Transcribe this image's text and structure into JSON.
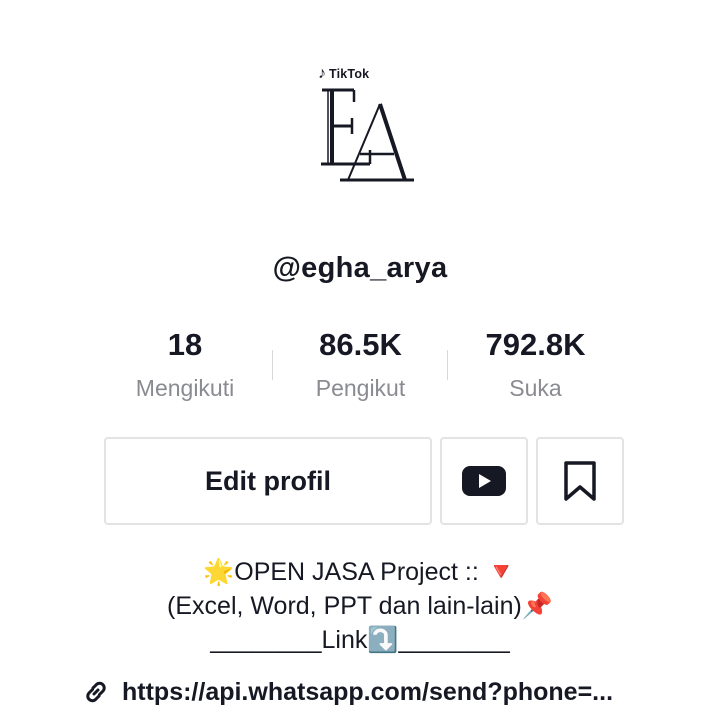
{
  "profile": {
    "logo_badge": "TikTok",
    "avatar_monogram": "EA",
    "username": "@egha_arya"
  },
  "stats": [
    {
      "value": "18",
      "label": "Mengikuti"
    },
    {
      "value": "86.5K",
      "label": "Pengikut"
    },
    {
      "value": "792.8K",
      "label": "Suka"
    }
  ],
  "actions": {
    "edit_label": "Edit profil",
    "youtube_icon": "youtube-icon",
    "bookmark_icon": "bookmark-icon"
  },
  "bio": {
    "line1": "🌟OPEN JASA Project :: 🔻",
    "line2": "(Excel, Word, PPT dan lain-lain)📌",
    "line3": "________Link⤵️________"
  },
  "link": {
    "icon": "link-icon",
    "text": "https://api.whatsapp.com/send?phone=..."
  }
}
